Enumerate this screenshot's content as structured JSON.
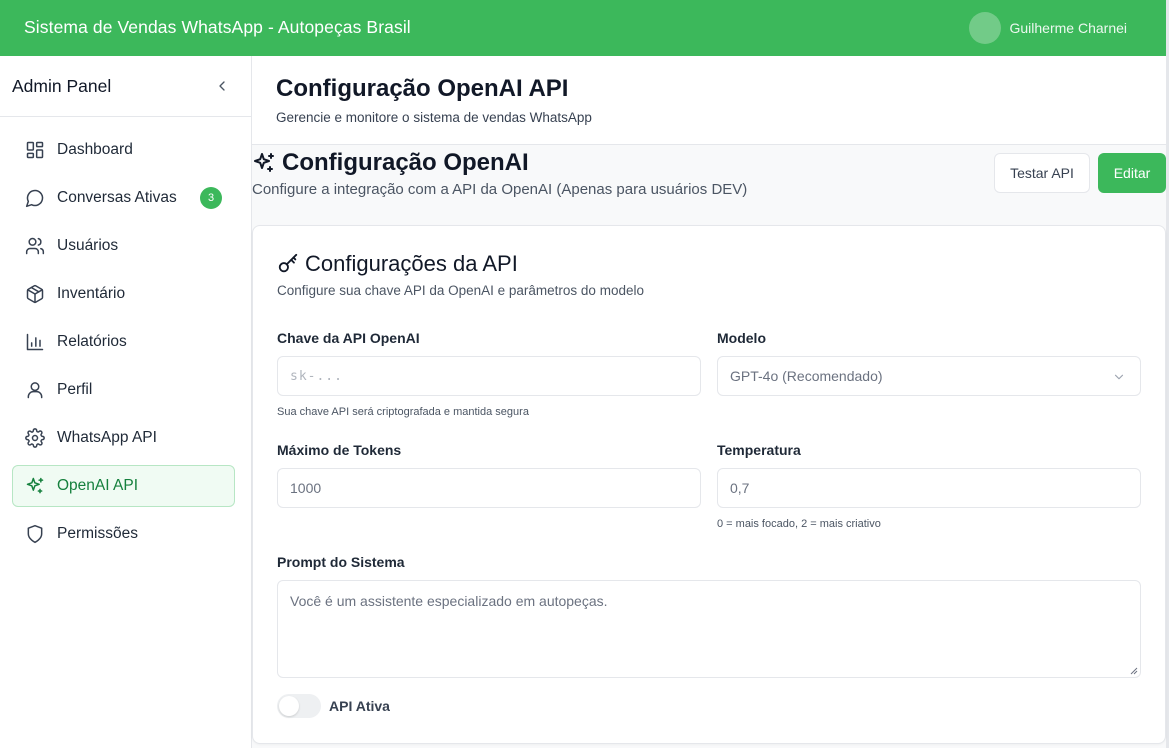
{
  "app": {
    "title": "Sistema de Vendas WhatsApp - Autopeças Brasil",
    "user_name": "Guilherme Charnei",
    "accent_color": "#3cb85b"
  },
  "sidebar": {
    "title": "Admin Panel",
    "collapse_icon": "chevron-left-icon",
    "items": [
      {
        "label": "Dashboard",
        "icon": "layout-grid-icon",
        "active": false
      },
      {
        "label": "Conversas Ativas",
        "icon": "message-circle-icon",
        "active": false,
        "badge": "3"
      },
      {
        "label": "Usuários",
        "icon": "users-icon",
        "active": false
      },
      {
        "label": "Inventário",
        "icon": "package-icon",
        "active": false
      },
      {
        "label": "Relatórios",
        "icon": "bar-chart-icon",
        "active": false
      },
      {
        "label": "Perfil",
        "icon": "user-icon",
        "active": false
      },
      {
        "label": "WhatsApp API",
        "icon": "gear-icon",
        "active": false
      },
      {
        "label": "OpenAI API",
        "icon": "sparkles-icon",
        "active": true
      },
      {
        "label": "Permissões",
        "icon": "shield-icon",
        "active": false
      }
    ]
  },
  "header": {
    "title": "Configuração OpenAI API",
    "subtitle": "Gerencie e monitore o sistema de vendas WhatsApp"
  },
  "section": {
    "title": "Configuração OpenAI",
    "subtitle": "Configure a integração com a API da OpenAI (Apenas para usuários DEV)",
    "test_button": "Testar API",
    "edit_button": "Editar"
  },
  "card": {
    "title": "Configurações da API",
    "subtitle": "Configure sua chave API da OpenAI e parâmetros do modelo",
    "api_key": {
      "label": "Chave da API OpenAI",
      "placeholder": "sk-...",
      "help": "Sua chave API será criptografada e mantida segura"
    },
    "model": {
      "label": "Modelo",
      "value": "GPT-4o (Recomendado)"
    },
    "max_tokens": {
      "label": "Máximo de Tokens",
      "value": "1000"
    },
    "temperature": {
      "label": "Temperatura",
      "value": "0,7",
      "help": "0 = mais focado, 2 = mais criativo"
    },
    "system_prompt": {
      "label": "Prompt do Sistema",
      "value": "Você é um assistente especializado em autopeças."
    },
    "api_active": {
      "label": "API Ativa",
      "enabled": false
    }
  }
}
